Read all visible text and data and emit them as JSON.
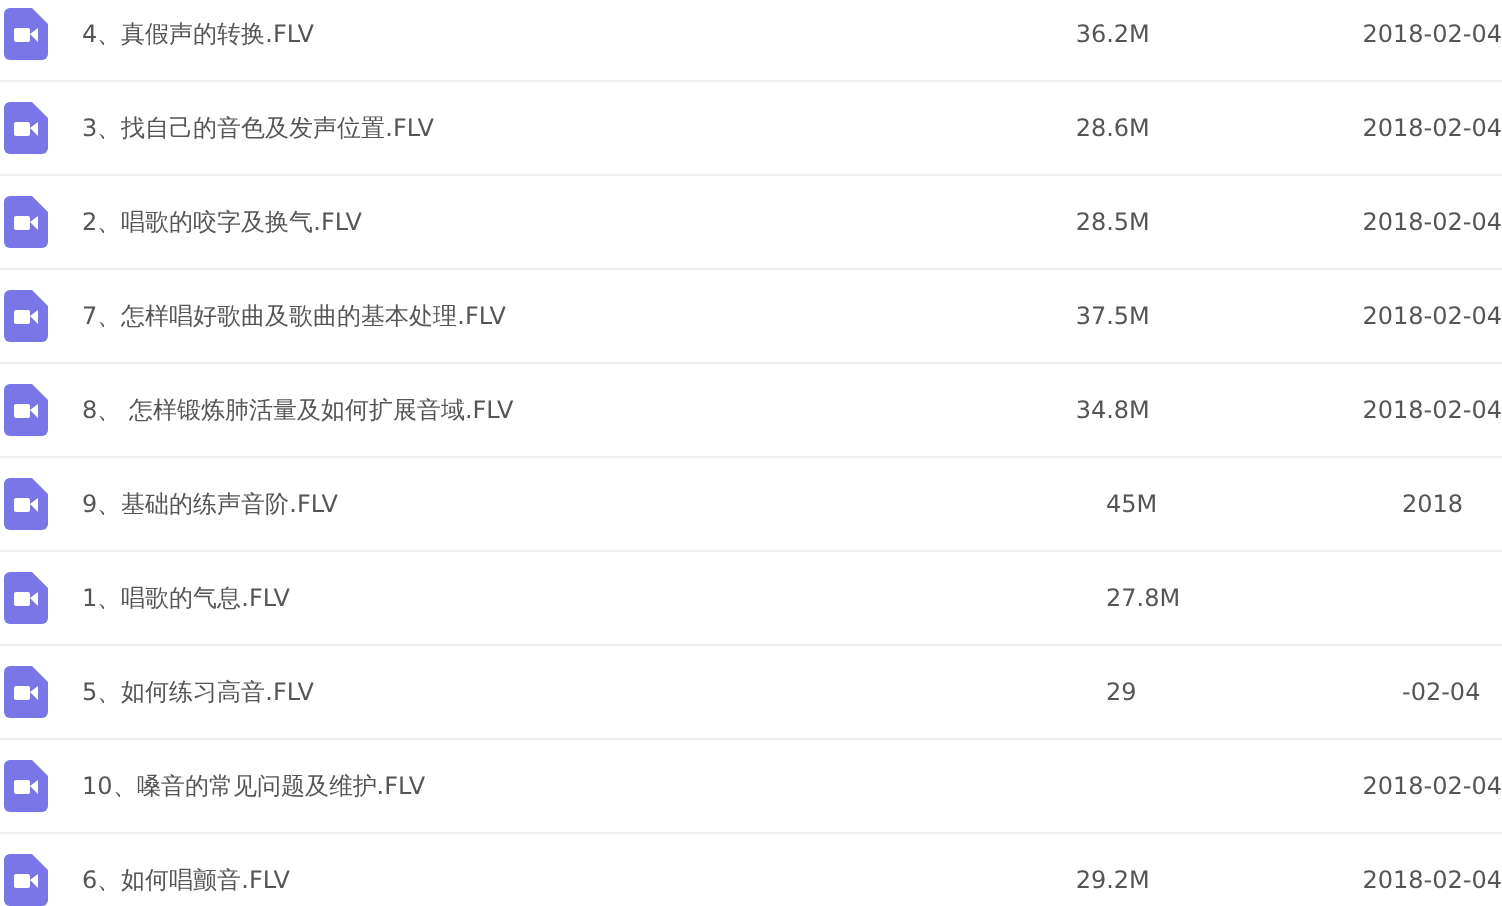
{
  "files": [
    {
      "name": "4、真假声的转换.FLV",
      "size": "36.2M",
      "date": "2018-02-04"
    },
    {
      "name": "3、找自己的音色及发声位置.FLV",
      "size": "28.6M",
      "date": "2018-02-04"
    },
    {
      "name": "2、唱歌的咬字及换气.FLV",
      "size": "28.5M",
      "date": "2018-02-04"
    },
    {
      "name": "7、怎样唱好歌曲及歌曲的基本处理.FLV",
      "size": "37.5M",
      "date": "2018-02-04"
    },
    {
      "name": "8、 怎样锻炼肺活量及如何扩展音域.FLV",
      "size": "34.8M",
      "date": "2018-02-04"
    },
    {
      "name": "9、基础的练声音阶.FLV",
      "size": "45M",
      "date": "2018"
    },
    {
      "name": "1、唱歌的气息.FLV",
      "size": "27.8M"
    },
    {
      "name": "5、如何练习高音.FLV",
      "size": "29",
      "date": "-02-04"
    },
    {
      "name": "10、嗓音的常见问题及维护.FLV",
      "date": "2018-02-04"
    },
    {
      "name": "6、如何唱颤音.FLV",
      "size": "29.2M",
      "date": "2018-02-04"
    }
  ]
}
